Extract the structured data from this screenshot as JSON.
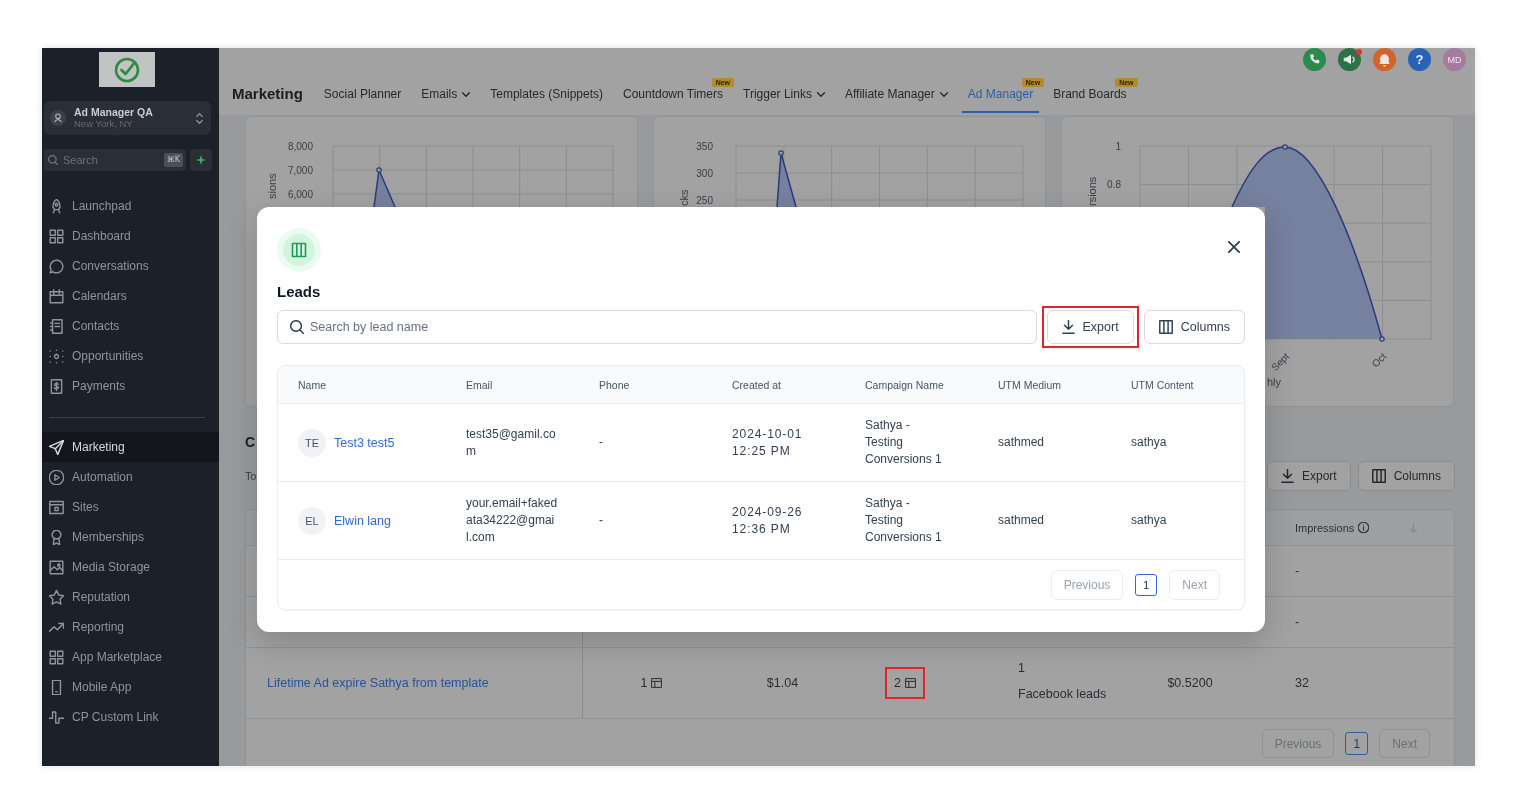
{
  "sidebar": {
    "account": {
      "name": "Ad Manager QA",
      "location": "New York, NY"
    },
    "search": {
      "placeholder": "Search",
      "shortcut": "⌘K"
    },
    "sections": [
      {
        "items": [
          {
            "label": "Launchpad",
            "selected": false
          },
          {
            "label": "Dashboard",
            "selected": false
          },
          {
            "label": "Conversations",
            "selected": false
          },
          {
            "label": "Calendars",
            "selected": false
          },
          {
            "label": "Contacts",
            "selected": false
          },
          {
            "label": "Opportunities",
            "selected": false
          },
          {
            "label": "Payments",
            "selected": false
          }
        ]
      },
      {
        "items": [
          {
            "label": "Marketing",
            "selected": true
          },
          {
            "label": "Automation",
            "selected": false
          },
          {
            "label": "Sites",
            "selected": false
          },
          {
            "label": "Memberships",
            "selected": false
          },
          {
            "label": "Media Storage",
            "selected": false
          },
          {
            "label": "Reputation",
            "selected": false
          },
          {
            "label": "Reporting",
            "selected": false
          },
          {
            "label": "App Marketplace",
            "selected": false
          },
          {
            "label": "Mobile App",
            "selected": false
          },
          {
            "label": "CP Custom Link",
            "selected": false
          }
        ]
      }
    ]
  },
  "top_bar": {
    "title": "Marketing",
    "tabs": [
      {
        "label": "Social Planner",
        "selected": false,
        "has_menu": false
      },
      {
        "label": "Emails",
        "selected": false,
        "has_menu": true
      },
      {
        "label": "Templates (Snippets)",
        "selected": false,
        "has_menu": false
      },
      {
        "label": "Countdown Timers",
        "selected": false,
        "has_menu": false,
        "badge": "New"
      },
      {
        "label": "Trigger Links",
        "selected": false,
        "has_menu": true
      },
      {
        "label": "Affiliate Manager",
        "selected": false,
        "has_menu": true
      },
      {
        "label": "Ad Manager",
        "selected": true,
        "has_menu": false,
        "badge": "New"
      },
      {
        "label": "Brand Boards",
        "selected": false,
        "has_menu": false,
        "badge": "New"
      }
    ],
    "help": "?",
    "avatar": "MD"
  },
  "charts": [
    {
      "y_label": "sions",
      "y_ticks": [
        "8,000",
        "7,000",
        "6,000"
      ]
    },
    {
      "y_label": "cks",
      "y_ticks": [
        "350",
        "300",
        "250"
      ]
    },
    {
      "y_label": "rsions",
      "y_ticks": [
        "1",
        "0.8"
      ],
      "x_labels": [
        "Sept",
        "Oct"
      ],
      "x_title": "hly"
    }
  ],
  "campaigns": {
    "title": "C",
    "subtitle": "To",
    "buttons": [
      {
        "kind": "export",
        "label": "Export"
      },
      {
        "kind": "columns",
        "label": "Columns"
      }
    ],
    "table": {
      "impressions_header": "Impressions",
      "rows": [
        {
          "impressions": "-"
        },
        {
          "impressions": "-"
        },
        {
          "name": "Lifetime Ad expire Sathya from template",
          "cells": [
            {
              "kind": "count",
              "text": "1",
              "highlighted": false
            },
            {
              "kind": "text",
              "text": "$1.04",
              "highlighted": false
            },
            {
              "kind": "count",
              "text": "2",
              "highlighted": true
            },
            {
              "kind": "stacked",
              "text": "1",
              "note": "Facebook leads",
              "highlighted": false
            },
            {
              "kind": "text",
              "text": "$0.5200",
              "highlighted": false
            }
          ],
          "impressions": "32"
        }
      ]
    },
    "pagination": {
      "previous": {
        "label": "Previous",
        "disabled": true
      },
      "pages": [
        {
          "label": "1",
          "selected": true
        }
      ],
      "next": {
        "label": "Next",
        "disabled": true
      }
    }
  },
  "modal": {
    "title": "Leads",
    "search": {
      "placeholder": "Search by lead name"
    },
    "buttons": [
      {
        "kind": "export",
        "label": "Export",
        "highlighted": true
      },
      {
        "kind": "columns",
        "label": "Columns",
        "highlighted": false
      }
    ],
    "table": {
      "columns": [
        "Name",
        "Email",
        "Phone",
        "Created at",
        "Campaign Name",
        "UTM Medium",
        "UTM Content"
      ],
      "rows": [
        {
          "initials": "TE",
          "name": "Test3 test5",
          "email": "test35@gamil.com",
          "phone": "-",
          "created_at": "2024-10-01 12:25 PM",
          "campaign": "Sathya - Testing Conversions 1",
          "utm_medium": "sathmed",
          "utm_content": "sathya"
        },
        {
          "initials": "EL",
          "name": "Elwin lang",
          "email": "your.email+fakedata34222@gmail.com",
          "phone": "-",
          "created_at": "2024-09-26 12:36 PM",
          "campaign": "Sathya - Testing Conversions 1",
          "utm_medium": "sathmed",
          "utm_content": "sathya"
        }
      ]
    },
    "pagination": {
      "previous": {
        "label": "Previous",
        "disabled": true
      },
      "pages": [
        {
          "label": "1",
          "selected": true
        }
      ],
      "next": {
        "label": "Next",
        "disabled": true
      }
    }
  }
}
